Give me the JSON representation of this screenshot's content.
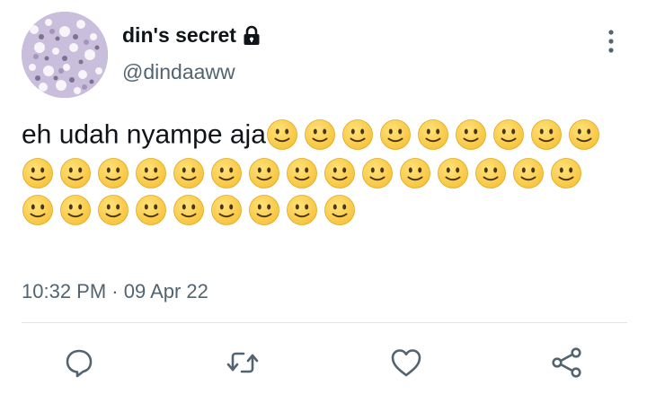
{
  "user": {
    "display_name": "din's secret",
    "handle": "@dindaaww",
    "protected_icon": "lock-icon",
    "avatar": "avatar-image"
  },
  "tweet": {
    "text": "eh udah nyampe aja",
    "emoji": "🙂",
    "emoji_count": 33,
    "timestamp": "10:32 PM · 09 Apr 22"
  },
  "menu": {
    "icon": "more-vertical-icon"
  },
  "actions": [
    {
      "name": "reply",
      "icon": "reply-icon"
    },
    {
      "name": "retweet",
      "icon": "retweet-icon"
    },
    {
      "name": "like",
      "icon": "heart-icon"
    },
    {
      "name": "share",
      "icon": "share-icon"
    }
  ],
  "colors": {
    "text_primary": "#0f1419",
    "text_secondary": "#536471",
    "divider": "#dfe3e6",
    "icon": "#536471",
    "emoji_face": "#f7c23a"
  }
}
